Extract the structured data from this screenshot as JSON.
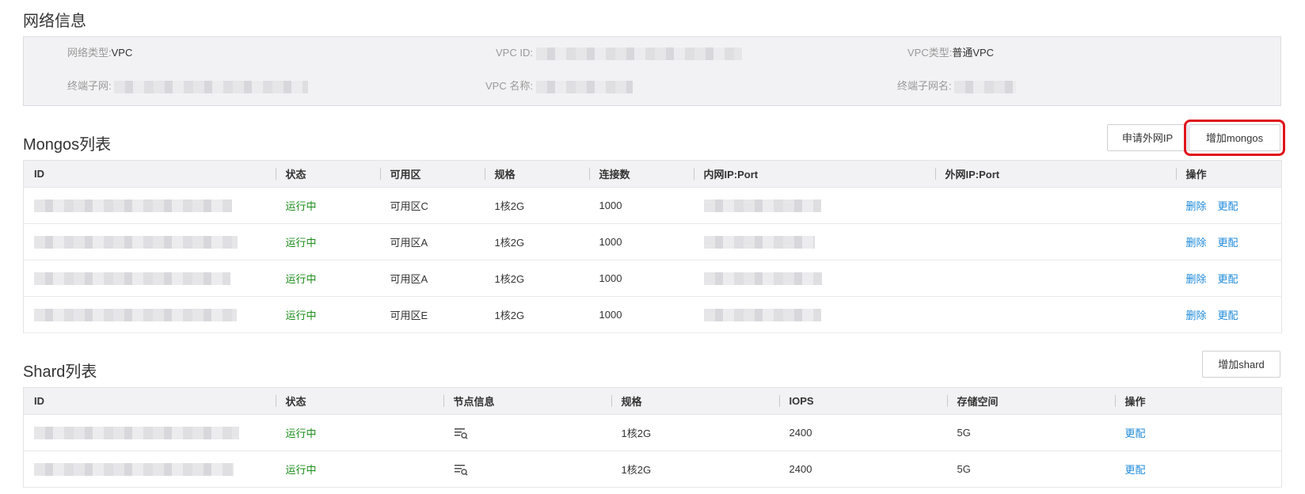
{
  "network": {
    "title": "网络信息",
    "fields": [
      {
        "label": "网络类型:",
        "value": "VPC"
      },
      {
        "label": "VPC ID:",
        "value": ""
      },
      {
        "label": "VPC类型:",
        "value": "普通VPC"
      },
      {
        "label": "终端子网:",
        "value": ""
      },
      {
        "label": "VPC 名称:",
        "value": ""
      },
      {
        "label": "终端子网名:",
        "value": ""
      }
    ]
  },
  "mongos": {
    "title": "Mongos列表",
    "buttons": {
      "apply_ip": "申请外网IP",
      "add": "增加mongos"
    },
    "columns": [
      "ID",
      "状态",
      "可用区",
      "规格",
      "连接数",
      "内网IP:Port",
      "外网IP:Port",
      "操作"
    ],
    "rows": [
      {
        "status": "运行中",
        "zone": "可用区C",
        "spec": "1核2G",
        "conn": "1000",
        "ext": "",
        "del": "删除",
        "cfg": "更配"
      },
      {
        "status": "运行中",
        "zone": "可用区A",
        "spec": "1核2G",
        "conn": "1000",
        "ext": "",
        "del": "删除",
        "cfg": "更配"
      },
      {
        "status": "运行中",
        "zone": "可用区A",
        "spec": "1核2G",
        "conn": "1000",
        "ext": "",
        "del": "删除",
        "cfg": "更配"
      },
      {
        "status": "运行中",
        "zone": "可用区E",
        "spec": "1核2G",
        "conn": "1000",
        "ext": "",
        "del": "删除",
        "cfg": "更配"
      }
    ]
  },
  "shard": {
    "title": "Shard列表",
    "buttons": {
      "add": "增加shard"
    },
    "columns": [
      "ID",
      "状态",
      "节点信息",
      "规格",
      "IOPS",
      "存储空间",
      "操作"
    ],
    "rows": [
      {
        "status": "运行中",
        "node_icon": "list-search-icon",
        "spec": "1核2G",
        "iops": "2400",
        "storage": "5G",
        "cfg": "更配"
      },
      {
        "status": "运行中",
        "node_icon": "list-search-icon",
        "spec": "1核2G",
        "iops": "2400",
        "storage": "5G",
        "cfg": "更配"
      }
    ]
  },
  "colors": {
    "running": "#1b8d1b",
    "link": "#1f8ad9",
    "highlight": "#e0141b"
  }
}
